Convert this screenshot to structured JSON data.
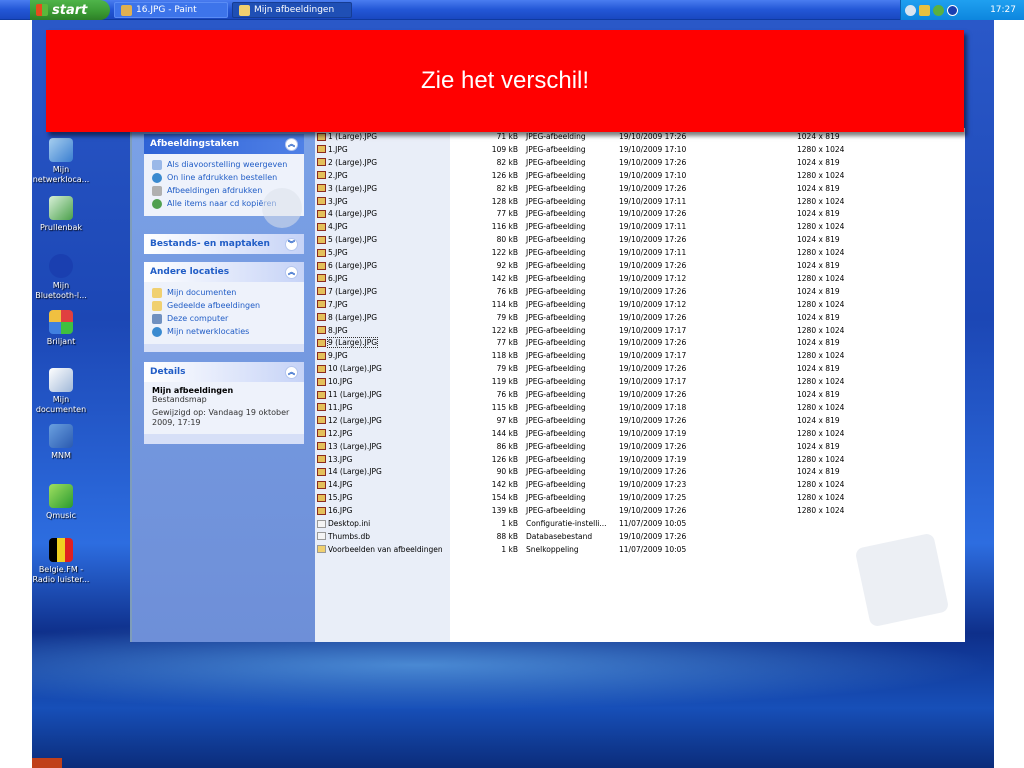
{
  "taskbar": {
    "start_label": "start",
    "tasks": [
      {
        "label": "16.JPG - Paint"
      },
      {
        "label": "Mijn afbeeldingen"
      }
    ],
    "clock": "17:27"
  },
  "banner": {
    "text": "Zie het verschil!"
  },
  "desktop_icons": [
    {
      "label": "Mijn\nnetwerkloca..."
    },
    {
      "label": "Prullenbak"
    },
    {
      "label": "Mijn\nBluetooth-l..."
    },
    {
      "label": "Briljant"
    },
    {
      "label": "Mijn\ndocumenten"
    },
    {
      "label": "MNM"
    },
    {
      "label": "Qmusic"
    },
    {
      "label": "Belgie.FM -\nRadio luister..."
    }
  ],
  "taskpane": {
    "images_panel": {
      "title": "Afbeeldingstaken",
      "links": [
        "Als diavoorstelling weergeven",
        "On line afdrukken bestellen",
        "Afbeeldingen afdrukken",
        "Alle items naar cd kopiëren"
      ]
    },
    "files_panel": {
      "title": "Bestands- en maptaken"
    },
    "locations_panel": {
      "title": "Andere locaties",
      "links": [
        "Mijn documenten",
        "Gedeelde afbeeldingen",
        "Deze computer",
        "Mijn netwerklocaties"
      ]
    },
    "details_panel": {
      "title": "Details",
      "name": "Mijn afbeeldingen",
      "type": "Bestandsmap",
      "modified_line1": "Gewijzigd op: Vandaag 19 oktober",
      "modified_line2": "2009, 17:19"
    }
  },
  "files": [
    {
      "name": "1 (Large).JPG",
      "size": "71 kB",
      "type": "JPEG-afbeelding",
      "date": "19/10/2009 17:26",
      "dims": "1024 x 819"
    },
    {
      "name": "1.JPG",
      "size": "109 kB",
      "type": "JPEG-afbeelding",
      "date": "19/10/2009 17:10",
      "dims": "1280 x 1024"
    },
    {
      "name": "2 (Large).JPG",
      "size": "82 kB",
      "type": "JPEG-afbeelding",
      "date": "19/10/2009 17:26",
      "dims": "1024 x 819"
    },
    {
      "name": "2.JPG",
      "size": "126 kB",
      "type": "JPEG-afbeelding",
      "date": "19/10/2009 17:10",
      "dims": "1280 x 1024"
    },
    {
      "name": "3 (Large).JPG",
      "size": "82 kB",
      "type": "JPEG-afbeelding",
      "date": "19/10/2009 17:26",
      "dims": "1024 x 819"
    },
    {
      "name": "3.JPG",
      "size": "128 kB",
      "type": "JPEG-afbeelding",
      "date": "19/10/2009 17:11",
      "dims": "1280 x 1024"
    },
    {
      "name": "4 (Large).JPG",
      "size": "77 kB",
      "type": "JPEG-afbeelding",
      "date": "19/10/2009 17:26",
      "dims": "1024 x 819"
    },
    {
      "name": "4.JPG",
      "size": "116 kB",
      "type": "JPEG-afbeelding",
      "date": "19/10/2009 17:11",
      "dims": "1280 x 1024"
    },
    {
      "name": "5 (Large).JPG",
      "size": "80 kB",
      "type": "JPEG-afbeelding",
      "date": "19/10/2009 17:26",
      "dims": "1024 x 819"
    },
    {
      "name": "5.JPG",
      "size": "122 kB",
      "type": "JPEG-afbeelding",
      "date": "19/10/2009 17:11",
      "dims": "1280 x 1024"
    },
    {
      "name": "6 (Large).JPG",
      "size": "92 kB",
      "type": "JPEG-afbeelding",
      "date": "19/10/2009 17:26",
      "dims": "1024 x 819"
    },
    {
      "name": "6.JPG",
      "size": "142 kB",
      "type": "JPEG-afbeelding",
      "date": "19/10/2009 17:12",
      "dims": "1280 x 1024"
    },
    {
      "name": "7 (Large).JPG",
      "size": "76 kB",
      "type": "JPEG-afbeelding",
      "date": "19/10/2009 17:26",
      "dims": "1024 x 819"
    },
    {
      "name": "7.JPG",
      "size": "114 kB",
      "type": "JPEG-afbeelding",
      "date": "19/10/2009 17:12",
      "dims": "1280 x 1024"
    },
    {
      "name": "8 (Large).JPG",
      "size": "79 kB",
      "type": "JPEG-afbeelding",
      "date": "19/10/2009 17:26",
      "dims": "1024 x 819"
    },
    {
      "name": "8.JPG",
      "size": "122 kB",
      "type": "JPEG-afbeelding",
      "date": "19/10/2009 17:17",
      "dims": "1280 x 1024"
    },
    {
      "name": "9 (Large).JPG",
      "size": "77 kB",
      "type": "JPEG-afbeelding",
      "date": "19/10/2009 17:26",
      "dims": "1024 x 819"
    },
    {
      "name": "9.JPG",
      "size": "118 kB",
      "type": "JPEG-afbeelding",
      "date": "19/10/2009 17:17",
      "dims": "1280 x 1024"
    },
    {
      "name": "10 (Large).JPG",
      "size": "79 kB",
      "type": "JPEG-afbeelding",
      "date": "19/10/2009 17:26",
      "dims": "1024 x 819"
    },
    {
      "name": "10.JPG",
      "size": "119 kB",
      "type": "JPEG-afbeelding",
      "date": "19/10/2009 17:17",
      "dims": "1280 x 1024"
    },
    {
      "name": "11 (Large).JPG",
      "size": "76 kB",
      "type": "JPEG-afbeelding",
      "date": "19/10/2009 17:26",
      "dims": "1024 x 819"
    },
    {
      "name": "11.JPG",
      "size": "115 kB",
      "type": "JPEG-afbeelding",
      "date": "19/10/2009 17:18",
      "dims": "1280 x 1024"
    },
    {
      "name": "12 (Large).JPG",
      "size": "97 kB",
      "type": "JPEG-afbeelding",
      "date": "19/10/2009 17:26",
      "dims": "1024 x 819"
    },
    {
      "name": "12.JPG",
      "size": "144 kB",
      "type": "JPEG-afbeelding",
      "date": "19/10/2009 17:19",
      "dims": "1280 x 1024"
    },
    {
      "name": "13 (Large).JPG",
      "size": "86 kB",
      "type": "JPEG-afbeelding",
      "date": "19/10/2009 17:26",
      "dims": "1024 x 819"
    },
    {
      "name": "13.JPG",
      "size": "126 kB",
      "type": "JPEG-afbeelding",
      "date": "19/10/2009 17:19",
      "dims": "1280 x 1024"
    },
    {
      "name": "14 (Large).JPG",
      "size": "90 kB",
      "type": "JPEG-afbeelding",
      "date": "19/10/2009 17:26",
      "dims": "1024 x 819"
    },
    {
      "name": "14.JPG",
      "size": "142 kB",
      "type": "JPEG-afbeelding",
      "date": "19/10/2009 17:23",
      "dims": "1280 x 1024"
    },
    {
      "name": "15.JPG",
      "size": "154 kB",
      "type": "JPEG-afbeelding",
      "date": "19/10/2009 17:25",
      "dims": "1280 x 1024"
    },
    {
      "name": "16.JPG",
      "size": "139 kB",
      "type": "JPEG-afbeelding",
      "date": "19/10/2009 17:26",
      "dims": "1280 x 1024"
    },
    {
      "name": "Desktop.ini",
      "size": "1 kB",
      "type": "Configuratie-instelli...",
      "date": "11/07/2009 10:05",
      "dims": ""
    },
    {
      "name": "Thumbs.db",
      "size": "88 kB",
      "type": "Databasebestand",
      "date": "19/10/2009 17:26",
      "dims": ""
    },
    {
      "name": "Voorbeelden van afbeeldingen",
      "size": "1 kB",
      "type": "Snelkoppeling",
      "date": "11/07/2009 10:05",
      "dims": ""
    }
  ]
}
